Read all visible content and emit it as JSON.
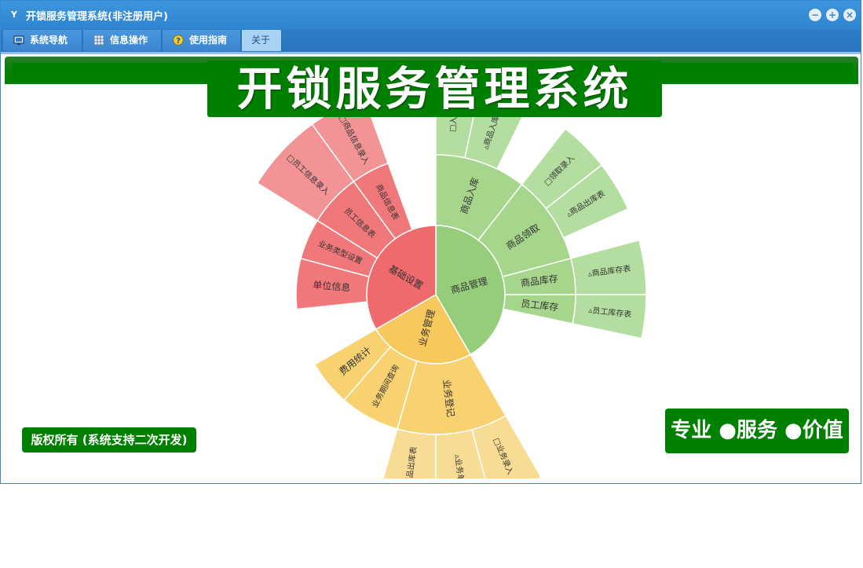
{
  "window": {
    "title": "开锁服务管理系统(非注册用户)",
    "logo_glyph": "Y",
    "controls": [
      "minimize-icon",
      "maximize-icon",
      "close-icon"
    ]
  },
  "menu": {
    "items": [
      {
        "label": "系统导航",
        "icon": "monitor-icon",
        "active": false
      },
      {
        "label": "信息操作",
        "icon": "grid-icon",
        "active": false
      },
      {
        "label": "使用指南",
        "icon": "help-icon",
        "active": false
      },
      {
        "label": "关于",
        "icon": "",
        "active": true
      }
    ]
  },
  "banner": {
    "title": "开锁服务管理系统"
  },
  "copyright": {
    "text": "版权所有 (系统支持二次开发)"
  },
  "slogan": {
    "text": "专业 ●服务 ●价值"
  },
  "sunburst": {
    "colors": {
      "green": {
        "l1": "#96cd7a",
        "l2": "#a6d68b",
        "l3": "#b4dea0"
      },
      "red": {
        "l1": "#ee6a6c",
        "l2": "#f0787a",
        "l3": "#f29496"
      },
      "yellow": {
        "l1": "#f7c85c",
        "l2": "#f8d170",
        "l3": "#f9dc93"
      }
    },
    "categories": [
      {
        "name": "商品管理",
        "color": "green",
        "children": [
          {
            "name": "商品入库",
            "children": [
              "□入库",
              "▵商品入库表"
            ]
          },
          {
            "name": "商品领取",
            "children": [
              "□领取录入",
              "▵商品出库表"
            ]
          },
          {
            "name": "商品库存",
            "children": [
              "▵商品库存表"
            ]
          },
          {
            "name": "员工库存",
            "children": [
              "▵员工库存表"
            ]
          }
        ]
      },
      {
        "name": "业务管理",
        "color": "yellow",
        "children": [
          {
            "name": "业务登记",
            "children": [
              "□业务录入",
              "▵业务单",
              "▵商品出库表"
            ]
          },
          {
            "name": "业务期间查询",
            "children": []
          },
          {
            "name": "费用统计",
            "children": []
          }
        ]
      },
      {
        "name": "基础设置",
        "color": "red",
        "children": [
          {
            "name": "单位信息",
            "children": []
          },
          {
            "name": "业务类型设置",
            "children": []
          },
          {
            "name": "员工信息表",
            "children": [
              "□员工信息录入"
            ]
          },
          {
            "name": "商品信息表",
            "children": [
              "□商品信息录入"
            ]
          }
        ]
      }
    ]
  }
}
